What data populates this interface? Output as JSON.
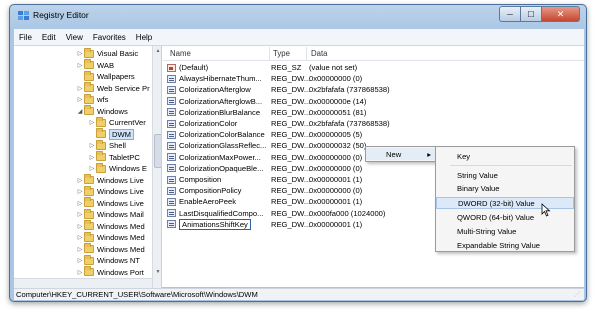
{
  "window": {
    "title": "Registry Editor"
  },
  "caption": {
    "minimize": "─",
    "maximize": "☐",
    "close": "✕"
  },
  "menu": [
    "File",
    "Edit",
    "View",
    "Favorites",
    "Help"
  ],
  "tree": [
    {
      "label": "Visual Basic",
      "expander": "▷"
    },
    {
      "label": "WAB",
      "expander": "▷"
    },
    {
      "label": "Wallpapers",
      "expander": ""
    },
    {
      "label": "Web Service Pr",
      "expander": "▷"
    },
    {
      "label": "wfs",
      "expander": "▷"
    },
    {
      "label": "Windows",
      "expander": "◢"
    },
    {
      "label": "CurrentVer",
      "expander": "▷"
    },
    {
      "label": "DWM",
      "expander": "",
      "selected": true
    },
    {
      "label": "Shell",
      "expander": "▷"
    },
    {
      "label": "TabletPC",
      "expander": "▷"
    },
    {
      "label": "Windows E",
      "expander": "▷"
    },
    {
      "label": "Windows Live",
      "expander": "▷"
    },
    {
      "label": "Windows Live",
      "expander": "▷"
    },
    {
      "label": "Windows Live",
      "expander": "▷"
    },
    {
      "label": "Windows Mail",
      "expander": "▷"
    },
    {
      "label": "Windows Med",
      "expander": "▷"
    },
    {
      "label": "Windows Med",
      "expander": "▷"
    },
    {
      "label": "Windows Med",
      "expander": "▷"
    },
    {
      "label": "Windows NT",
      "expander": "▷"
    },
    {
      "label": "Windows Port",
      "expander": "▷"
    }
  ],
  "list": {
    "headers": {
      "name": "Name",
      "type": "Type",
      "data": "Data"
    },
    "rows": [
      {
        "name": "(Default)",
        "type": "REG_SZ",
        "data": "(value not set)",
        "icon": "string-value-icon"
      },
      {
        "name": "AlwaysHibernateThum...",
        "type": "REG_DW...",
        "data": "0x00000000 (0)",
        "icon": "dword-value-icon"
      },
      {
        "name": "ColorizationAfterglow",
        "type": "REG_DW...",
        "data": "0x2bfafafa (737868538)",
        "icon": "dword-value-icon"
      },
      {
        "name": "ColorizationAfterglowB...",
        "type": "REG_DW...",
        "data": "0x0000000e (14)",
        "icon": "dword-value-icon"
      },
      {
        "name": "ColorizationBlurBalance",
        "type": "REG_DW...",
        "data": "0x00000051 (81)",
        "icon": "dword-value-icon"
      },
      {
        "name": "ColorizationColor",
        "type": "REG_DW...",
        "data": "0x2bfafafa (737868538)",
        "icon": "dword-value-icon"
      },
      {
        "name": "ColorizationColorBalance",
        "type": "REG_DW...",
        "data": "0x00000005 (5)",
        "icon": "dword-value-icon"
      },
      {
        "name": "ColorizationGlassReflec...",
        "type": "REG_DW...",
        "data": "0x00000032 (50)",
        "icon": "dword-value-icon"
      },
      {
        "name": "ColorizationMaxPower...",
        "type": "REG_DW...",
        "data": "0x00000000 (0)",
        "icon": "dword-value-icon"
      },
      {
        "name": "ColorizationOpaqueBle...",
        "type": "REG_DW...",
        "data": "0x00000000 (0)",
        "icon": "dword-value-icon"
      },
      {
        "name": "Composition",
        "type": "REG_DW...",
        "data": "0x00000001 (1)",
        "icon": "dword-value-icon"
      },
      {
        "name": "CompositionPolicy",
        "type": "REG_DW...",
        "data": "0x00000000 (0)",
        "icon": "dword-value-icon"
      },
      {
        "name": "EnableAeroPeek",
        "type": "REG_DW...",
        "data": "0x00000001 (1)",
        "icon": "dword-value-icon"
      },
      {
        "name": "LastDisqualifiedCompo...",
        "type": "REG_DW...",
        "data": "0x000fa000 (1024000)",
        "icon": "dword-value-icon"
      },
      {
        "name": "AnimationsShiftKey",
        "type": "REG_DW...",
        "data": "0x00000001 (1)",
        "icon": "dword-value-icon",
        "editing": true
      }
    ]
  },
  "context_menu": {
    "new_label": "New",
    "arrow": "▸"
  },
  "submenu": {
    "items": [
      "Key",
      "String Value",
      "Binary Value",
      "DWORD (32-bit) Value",
      "QWORD (64-bit) Value",
      "Multi-String Value",
      "Expandable String Value"
    ],
    "highlighted": "DWORD (32-bit) Value"
  },
  "status": {
    "path": "Computer\\HKEY_CURRENT_USER\\Software\\Microsoft\\Windows\\DWM"
  }
}
